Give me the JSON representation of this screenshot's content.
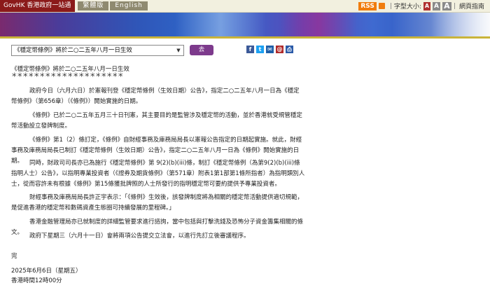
{
  "topbar": {
    "govhk_label": "GovHK 香港政府一站通",
    "languages": [
      "繁體版",
      "English"
    ],
    "rss_label": "RSS",
    "font_size_label": "字型大小:",
    "font_sizes": [
      "A",
      "A",
      "A"
    ],
    "mobile_label": "網頁指南"
  },
  "controls": {
    "select_value": "《穩定幣條例》將於二○二五年八月一日生效",
    "go_label": "去"
  },
  "share_icons": [
    "facebook-icon",
    "twitter-icon",
    "mail-icon",
    "email-icon",
    "print-icon"
  ],
  "article": {
    "title": "《穩定幣條例》將於二○二五年八月一日生效",
    "stars": "＊＊＊＊＊＊＊＊＊＊＊＊＊＊＊＊＊＊＊＊",
    "paragraphs": [
      "政府今日（六月六日）於憲報刊登《穩定幣條例（生效日期）公告》，指定二○二五年八月一日為《穩定幣條例》（第656章）（《條例》）開始實施的日期。",
      "《條例》已於二○二五年五月三十日刊憲，其主要目的是監管涉及穩定幣的活動，並於香港就受規管穩定幣活動設立發牌制度。",
      "《條例》第1（2）條訂定，《條例》自財經事務及庫務局局長以憲報公告指定的日期起實施。就此，財經事務及庫務局局長已制訂《穩定幣條例（生效日期）公告》，指定二○二五年八月一日為《條例》開始實施的日期。",
      "同時，財政司司長亦已為施行《穩定幣條例》第 9(2)(b)(iii)條，制訂《穩定幣條例（為第9(2)(b)(iii)條指明人士）公告》，以指明專業投資者（《證券及期貨條例》（第571章）附表1第1部第1條所指者）為指明類別人士，從而容許未有根據《條例》第15條獲批牌照的人士所發行的指明穩定幣可要約提供予專業投資者。",
      "財經事務及庫務局局長許正宇表示：「《條例》生效後，該發牌制度將為相關的穩定幣活動提供適切規範，是促進香港的穩定幣和數碼資產生態圈可持續發展的里程碑。」",
      "香港金融管理局亦已就制度的詳細監管要求進行諮詢，當中包括與打擊洗錢及恐怖分子資金籌集相關的條文。",
      "政府下星期三（六月十一日）會將兩項公告提交立法會，以進行先訂立後審議程序。"
    ],
    "end": "完",
    "date": "2025年6月6日（星期五）",
    "time": "香港時間12時00分"
  },
  "colors": {
    "govhk_red": "#8b1a1a",
    "go_button": "#7d3a8c",
    "topbar_bg": "#f2f0df",
    "rss_orange": "#f07c0c"
  }
}
